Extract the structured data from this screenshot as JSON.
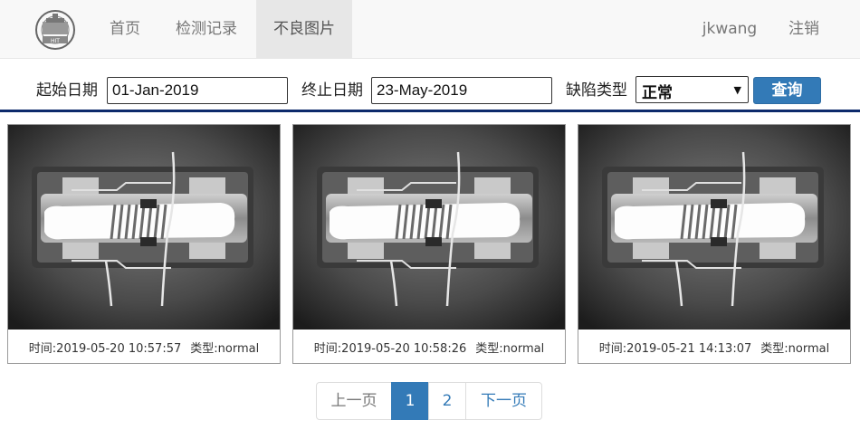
{
  "nav": {
    "items": [
      {
        "label": "首页",
        "active": false
      },
      {
        "label": "检测记录",
        "active": false
      },
      {
        "label": "不良图片",
        "active": true
      }
    ],
    "user": "jkwang",
    "logout": "注销",
    "logo_text": "HIT"
  },
  "filter": {
    "start_label": "起始日期",
    "start_value": "01-Jan-2019",
    "end_label": "终止日期",
    "end_value": "23-May-2019",
    "type_label": "缺陷类型",
    "type_value": "正常",
    "query_label": "查询"
  },
  "cards": [
    {
      "time_text": "时间:2019-05-20 10:57:57",
      "type_text": "类型:normal"
    },
    {
      "time_text": "时间:2019-05-20 10:58:26",
      "type_text": "类型:normal"
    },
    {
      "time_text": "时间:2019-05-21 14:13:07",
      "type_text": "类型:normal"
    }
  ],
  "pagination": {
    "prev": "上一页",
    "pages": [
      "1",
      "2"
    ],
    "current": "1",
    "next": "下一页"
  },
  "colors": {
    "primary": "#337ab7",
    "rule": "#0d2a6b",
    "nav_bg": "#f8f8f8"
  }
}
